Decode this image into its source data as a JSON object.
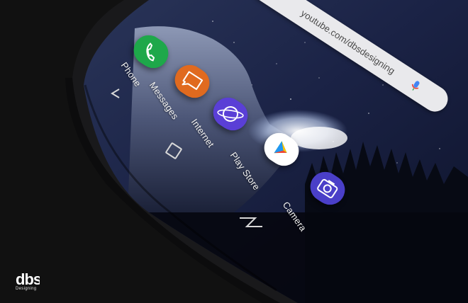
{
  "search_bar": {
    "text": "youtube.com/dbsdesigning",
    "mic_icon": "mic-icon"
  },
  "dock": [
    {
      "label": "Phone",
      "icon": "phone-icon",
      "color": "#1ea84a"
    },
    {
      "label": "Messages",
      "icon": "messages-icon",
      "color": "#e06a1f"
    },
    {
      "label": "Internet",
      "icon": "internet-icon",
      "color": "#5a3fd6"
    },
    {
      "label": "Play Store",
      "icon": "play-store-icon",
      "color": "#ffffff"
    },
    {
      "label": "Camera",
      "icon": "camera-icon",
      "color": "#4a3fc8"
    }
  ],
  "nav": {
    "back": "back-icon",
    "home": "home-icon",
    "recents": "recents-icon"
  },
  "watermark": {
    "logo": "dbs",
    "sub": "Designing"
  },
  "colors": {
    "background": "#111111",
    "device_body": "#1a1a1c",
    "search_bar": "#e9e9ec"
  }
}
